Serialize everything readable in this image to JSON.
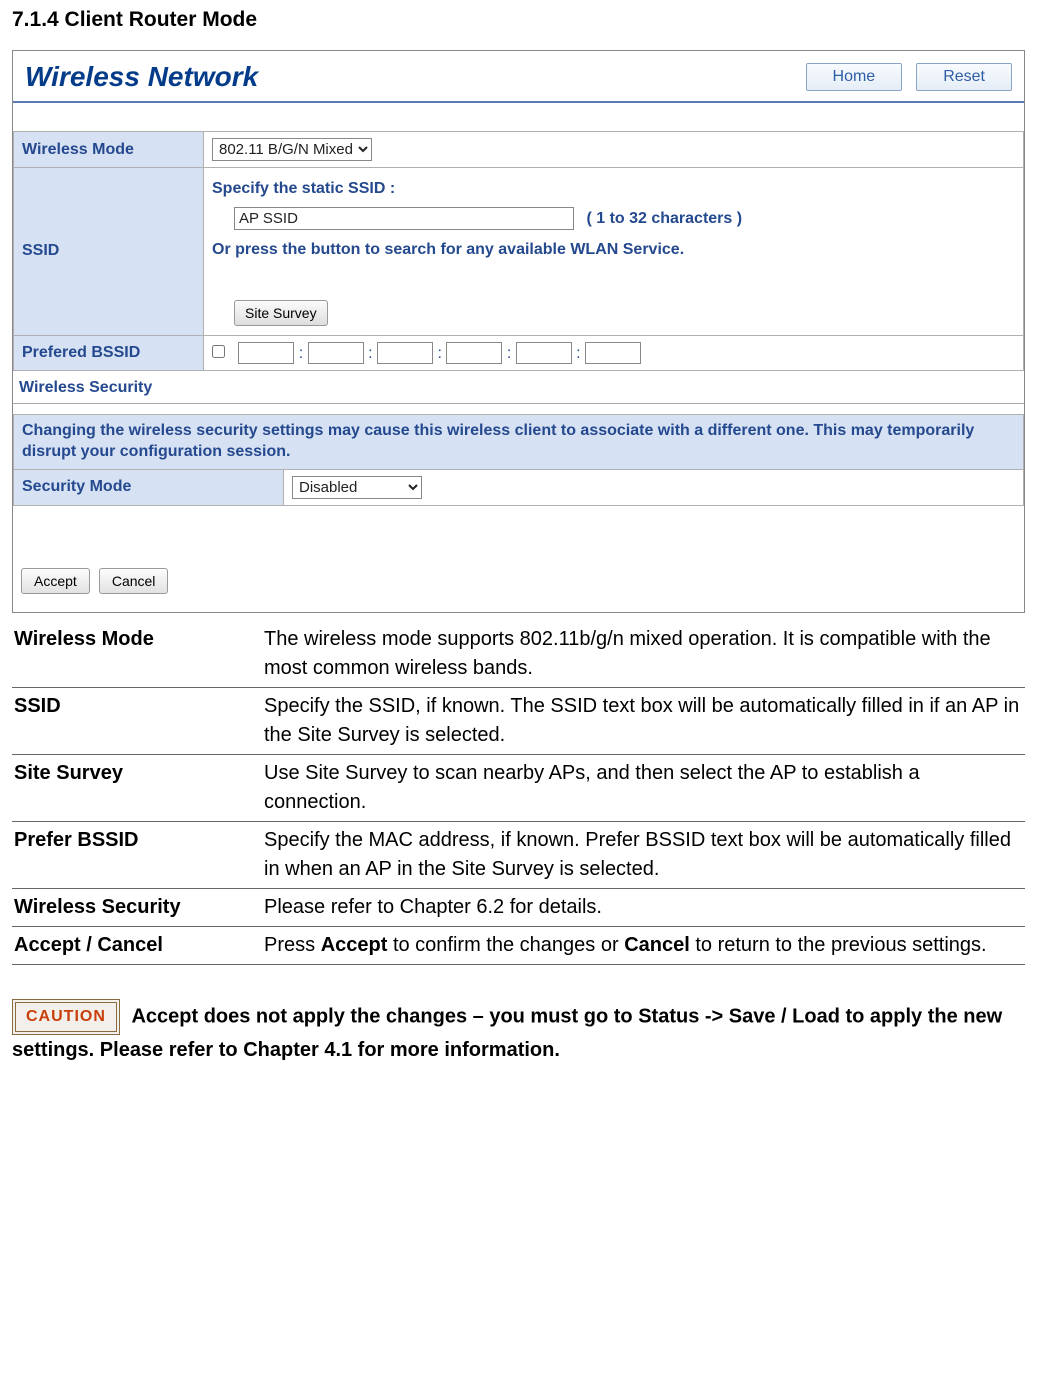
{
  "heading": "7.1.4 Client Router Mode",
  "router": {
    "title": "Wireless Network",
    "home": "Home",
    "reset": "Reset",
    "wireless_mode_label": "Wireless Mode",
    "wireless_mode_value": "802.11 B/G/N Mixed",
    "ssid_label": "SSID",
    "ssid_static_text": "Specify the static SSID  :",
    "ssid_input_value": "AP SSID",
    "ssid_hint": "( 1 to 32 characters )",
    "ssid_or_text": "Or press the button to search for any available WLAN Service.",
    "site_survey_btn": "Site Survey",
    "bssid_label": "Prefered BSSID",
    "security_header": "Wireless Security",
    "security_warning": "Changing the wireless security settings may cause this wireless client to associate with a different one. This may temporarily disrupt your configuration session.",
    "security_mode_label": "Security Mode",
    "security_mode_value": "Disabled",
    "accept": "Accept",
    "cancel": "Cancel"
  },
  "definitions": [
    {
      "term": "Wireless Mode",
      "desc": "The wireless mode supports 802.11b/g/n mixed operation. It is compatible with the most common wireless bands."
    },
    {
      "term": "SSID",
      "desc": "Specify the SSID, if known. The SSID text box will be automatically filled in if an AP in the Site Survey is selected."
    },
    {
      "term": "Site Survey",
      "desc": "Use Site Survey to scan nearby APs, and then select the AP to establish a connection."
    },
    {
      "term": "Prefer BSSID",
      "desc": "Specify the MAC address, if known. Prefer BSSID text box will be automatically filled in when an AP in the Site Survey is selected."
    },
    {
      "term": "Wireless Security",
      "desc": "Please refer to Chapter 6.2 for details."
    },
    {
      "term": "Accept / Cancel",
      "desc_pre": "Press ",
      "desc_accept": "Accept",
      "desc_mid": " to confirm the changes or ",
      "desc_cancel": "Cancel",
      "desc_post": " to return to the previous settings."
    }
  ],
  "caution": {
    "badge": "CAUTION",
    "text": "Accept does not apply the changes – you must go to Status -> Save / Load to apply the new settings. Please refer to Chapter 4.1 for more information."
  }
}
